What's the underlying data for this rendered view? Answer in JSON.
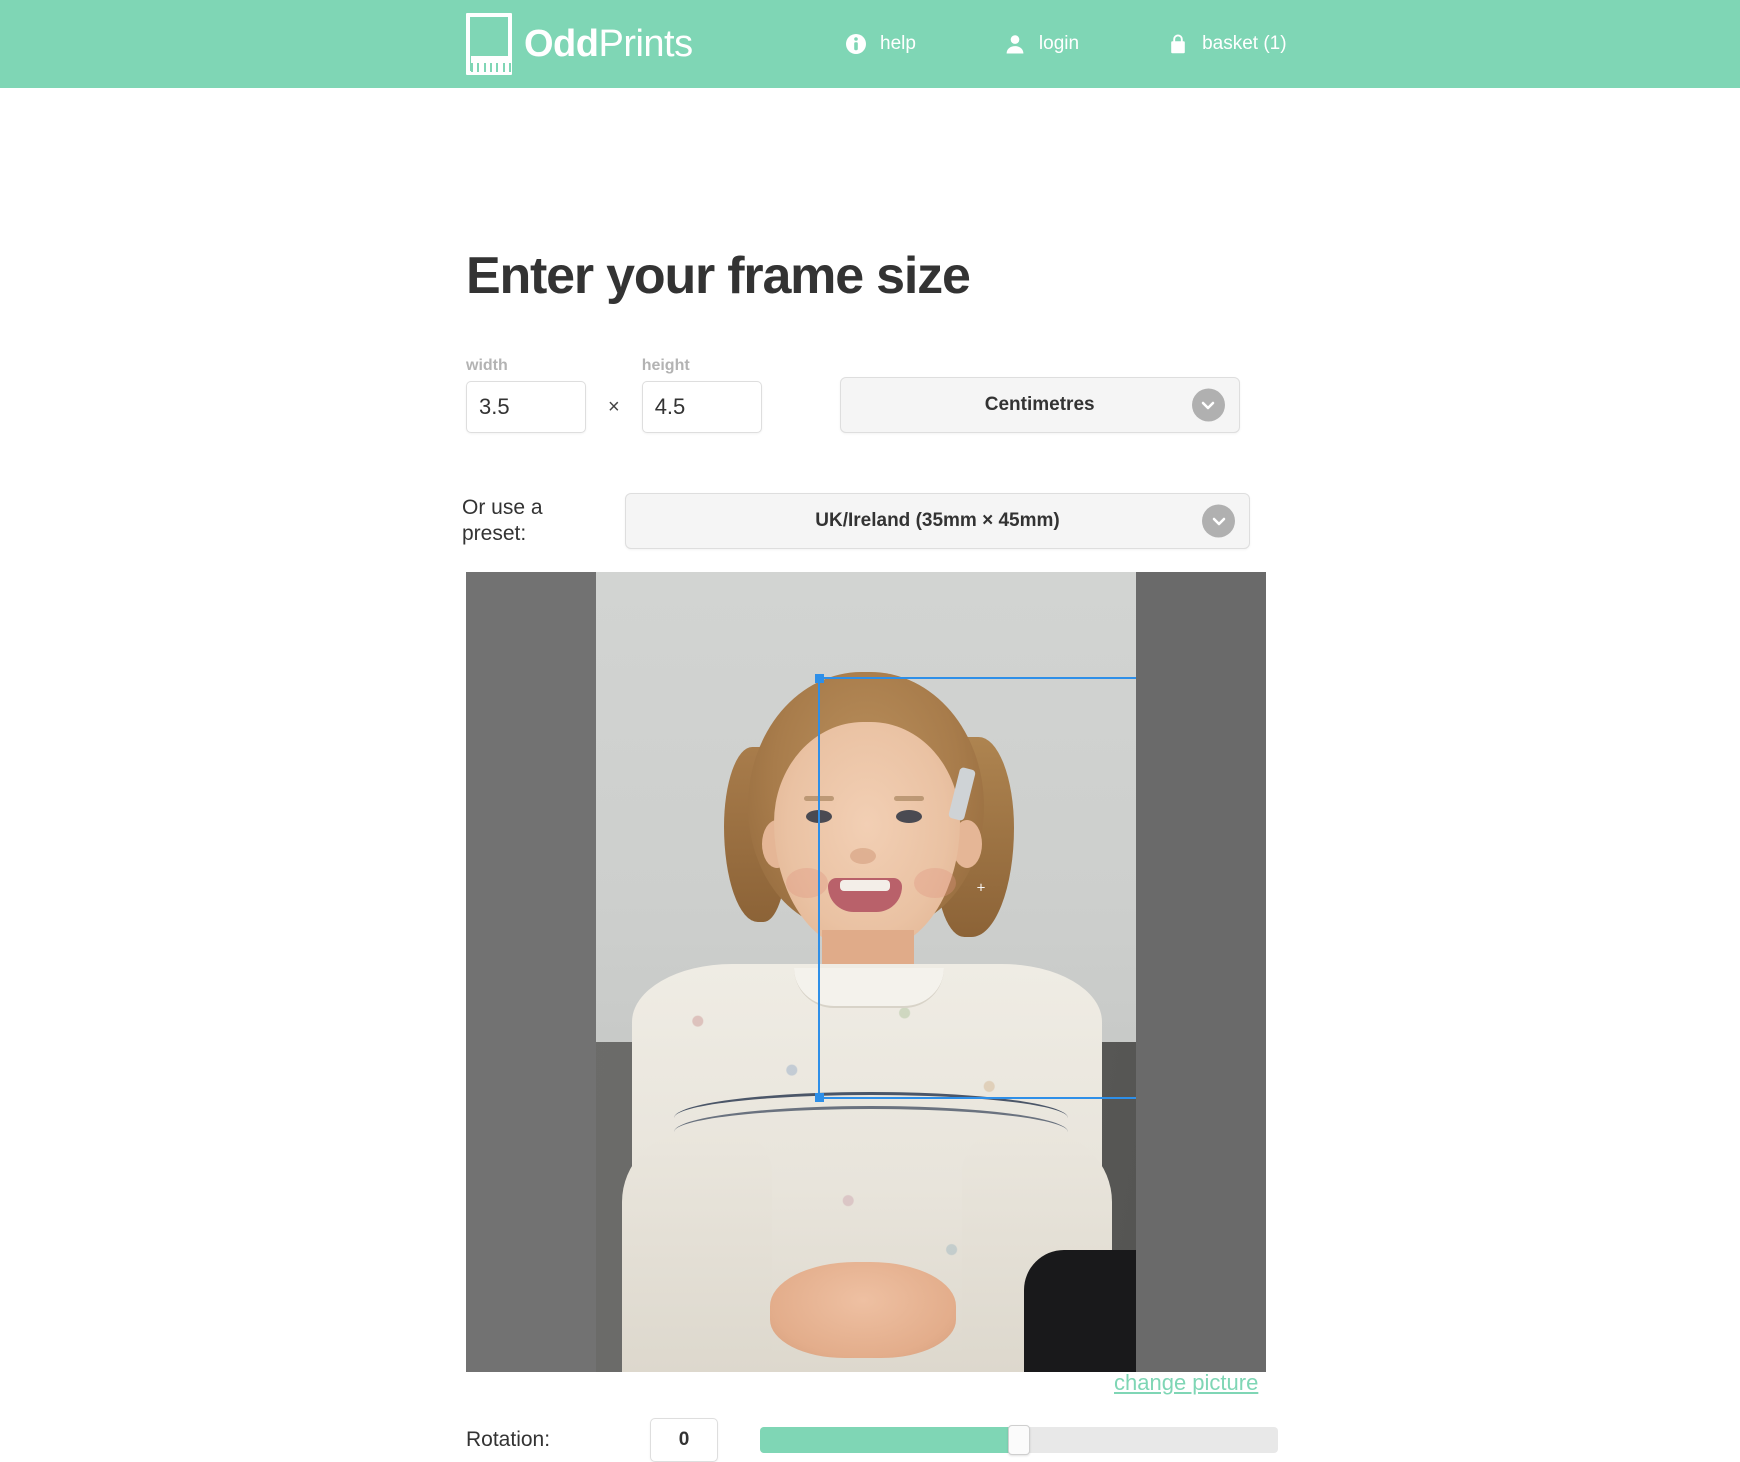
{
  "header": {
    "brand": {
      "bold": "Odd",
      "light": "Prints",
      "logo_icon": "picture-frame-ruler-icon"
    },
    "accent_color": "#7fd6b5",
    "nav": [
      {
        "label": "help",
        "icon": "info-icon"
      },
      {
        "label": "login",
        "icon": "user-icon"
      },
      {
        "label": "basket (1)",
        "icon": "basket-icon"
      }
    ]
  },
  "main": {
    "title": "Enter your frame size",
    "size": {
      "width_label": "width",
      "width_value": "3.5",
      "separator": "×",
      "height_label": "height",
      "height_value": "4.5",
      "unit_selected": "Centimetres"
    },
    "preset": {
      "label": "Or use a preset:",
      "selected": "UK/Ireland (35mm × 45mm)"
    },
    "editor": {
      "change_picture_label": "change picture",
      "crop_selection_color": "#2e8fe8"
    },
    "rotation": {
      "label": "Rotation:",
      "value": "0",
      "slider_percent": 50,
      "slider_fill_color": "#7fd6b5"
    }
  }
}
